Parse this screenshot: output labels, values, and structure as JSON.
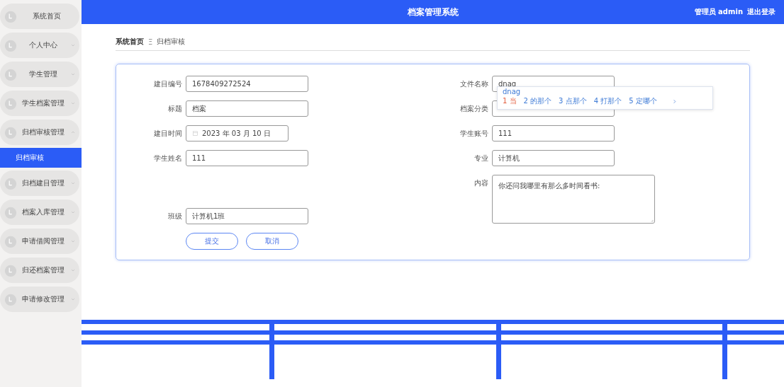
{
  "header": {
    "title": "档案管理系统",
    "user": "管理员 admin",
    "logout": "退出登录"
  },
  "sidebar": {
    "items": [
      {
        "label": "系统首页",
        "kind": "link"
      },
      {
        "label": "个人中心",
        "kind": "menu",
        "expanded": false
      },
      {
        "label": "学生管理",
        "kind": "menu",
        "expanded": false
      },
      {
        "label": "学生档案管理",
        "kind": "menu",
        "expanded": false
      },
      {
        "label": "归档审核管理",
        "kind": "menu",
        "expanded": true,
        "children": [
          {
            "label": "归档审核",
            "selected": true
          }
        ]
      },
      {
        "label": "归档建目管理",
        "kind": "menu",
        "expanded": false
      },
      {
        "label": "档案入库管理",
        "kind": "menu",
        "expanded": false
      },
      {
        "label": "申请借阅管理",
        "kind": "menu",
        "expanded": false
      },
      {
        "label": "归还档案管理",
        "kind": "menu",
        "expanded": false
      },
      {
        "label": "申请修改管理",
        "kind": "menu",
        "expanded": false
      }
    ]
  },
  "breadcrumb": {
    "items": [
      "系统首页",
      "归档审核"
    ],
    "separator": "Ξ"
  },
  "form": {
    "left": [
      {
        "label": "建目编号",
        "value": "1678409272524",
        "kind": "text"
      },
      {
        "label": "标题",
        "value": "档案",
        "kind": "text"
      },
      {
        "label": "建目时间",
        "value": "2023 年 03 月 10 日",
        "kind": "date"
      },
      {
        "label": "学生姓名",
        "value": "111",
        "kind": "text"
      },
      {
        "label": "班级",
        "value": "计算机1班",
        "kind": "text"
      }
    ],
    "right": [
      {
        "label": "文件名称",
        "value": "dnag",
        "kind": "text"
      },
      {
        "label": "档案分类",
        "kind": "text"
      },
      {
        "label": "学生账号",
        "value": "111",
        "kind": "text"
      },
      {
        "label": "专业",
        "value": "计算机",
        "kind": "text"
      },
      {
        "label": "内容",
        "value": "你还问我哪里有那么多时间看书:",
        "kind": "textarea"
      }
    ],
    "buttons": [
      "提交",
      "取消"
    ]
  },
  "ime": {
    "composition": "dnag",
    "candidates": [
      {
        "label": "1 当",
        "selected": true
      },
      {
        "label": "2 的那个",
        "selected": false
      },
      {
        "label": "3 点那个",
        "selected": false
      },
      {
        "label": "4 打那个",
        "selected": false
      },
      {
        "label": "5 定哪个",
        "selected": false
      }
    ]
  }
}
